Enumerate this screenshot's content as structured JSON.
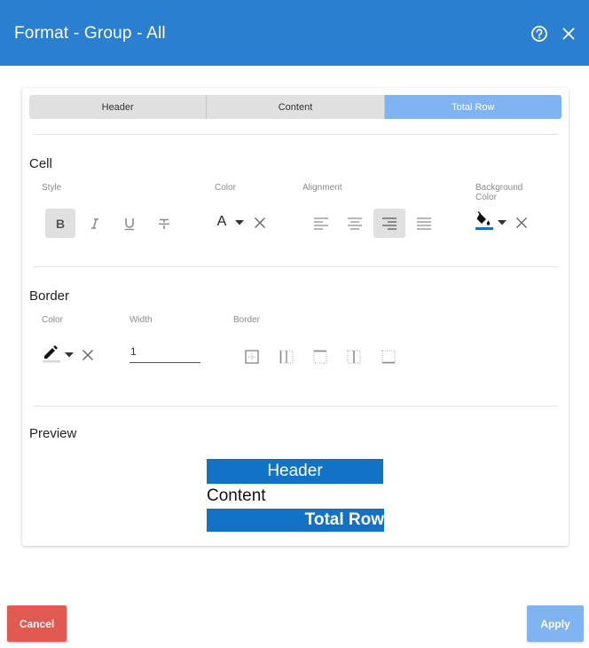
{
  "dialog": {
    "title": "Format - Group - All",
    "help_icon": "help-circle-icon",
    "close_icon": "close-icon"
  },
  "tabs": [
    {
      "label": "Header",
      "active": false
    },
    {
      "label": "Content",
      "active": false
    },
    {
      "label": "Total Row",
      "active": true
    }
  ],
  "cell": {
    "title": "Cell",
    "style_label": "Style",
    "color_label": "Color",
    "alignment_label": "Alignment",
    "background_label_line1": "Background",
    "background_label_line2": "Color",
    "font_color_glyph": "A",
    "style_buttons": [
      {
        "icon": "bold-icon",
        "selected": true
      },
      {
        "icon": "italic-icon",
        "selected": false
      },
      {
        "icon": "underline-icon",
        "selected": false
      },
      {
        "icon": "strikethrough-icon",
        "selected": false
      }
    ],
    "alignment_buttons": [
      {
        "icon": "align-left-icon",
        "selected": false
      },
      {
        "icon": "align-center-icon",
        "selected": false
      },
      {
        "icon": "align-right-icon",
        "selected": true
      },
      {
        "icon": "align-justify-icon",
        "selected": false
      }
    ],
    "background_swatch_color": "#1172c6"
  },
  "border": {
    "title": "Border",
    "color_label": "Color",
    "width_label": "Width",
    "border_label": "Border",
    "width_value": "1",
    "border_buttons": [
      {
        "icon": "border-outer-icon"
      },
      {
        "icon": "border-left-icon"
      },
      {
        "icon": "border-top-icon"
      },
      {
        "icon": "border-vertical-icon"
      },
      {
        "icon": "border-bottom-icon"
      }
    ]
  },
  "preview": {
    "title": "Preview",
    "header_text": "Header",
    "content_text": "Content",
    "total_text": "Total Row"
  },
  "footer": {
    "cancel_label": "Cancel",
    "apply_label": "Apply"
  },
  "colors": {
    "titlebar": "#2a7fd0",
    "active_tab": "#7fb3f2",
    "preview_fill": "#1172c6",
    "cancel": "#e05a52",
    "apply": "#80b3f2"
  }
}
